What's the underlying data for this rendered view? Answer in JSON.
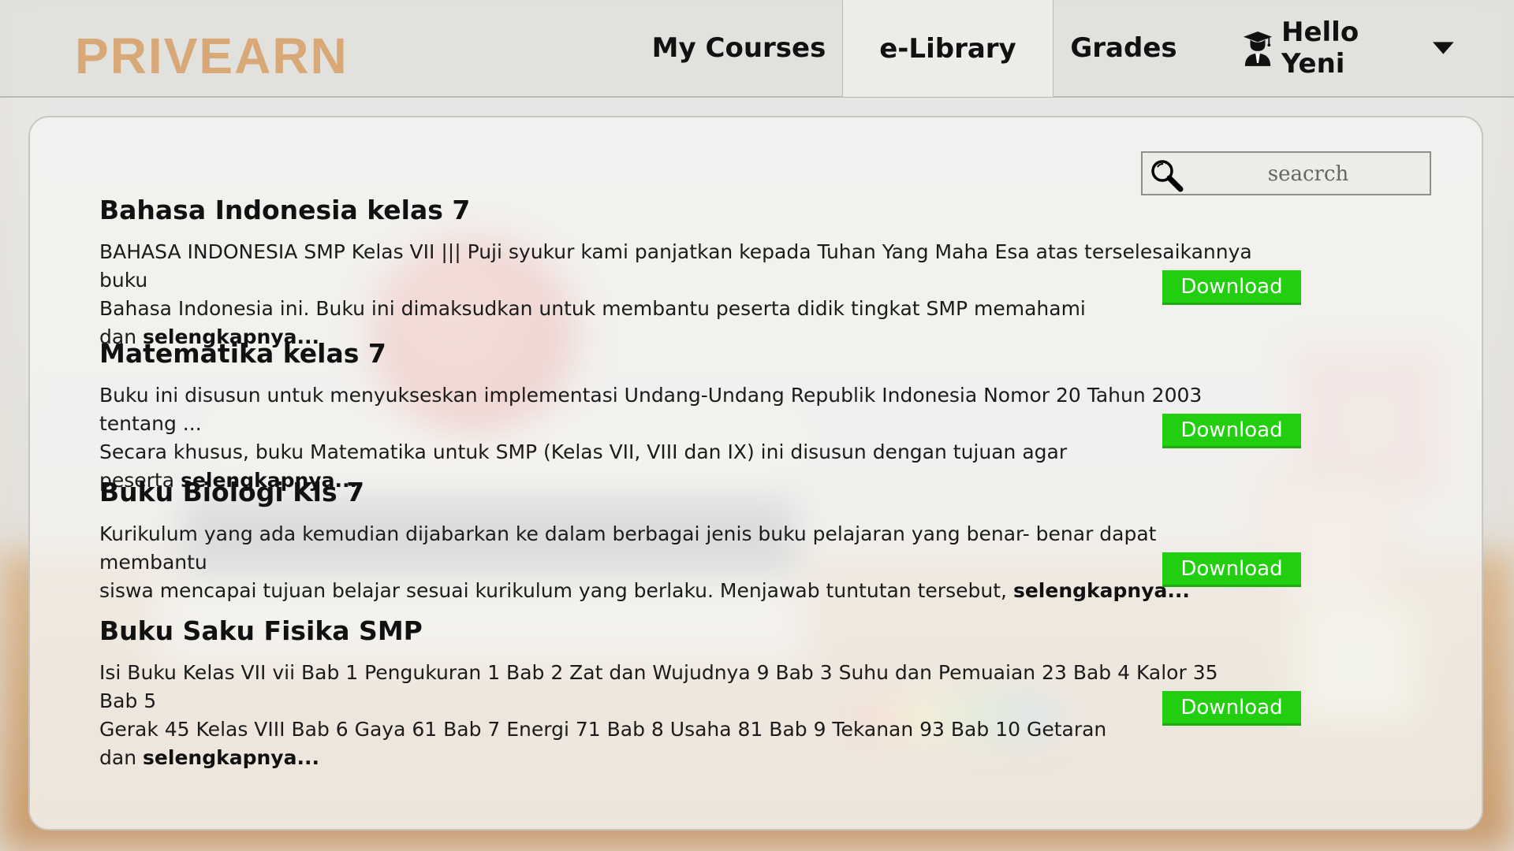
{
  "header": {
    "logo": "PRIVEARN",
    "nav": {
      "my_courses": "My Courses",
      "e_library": "e-Library",
      "grades": "Grades"
    },
    "user": {
      "greeting": "Hello Yeni",
      "icon": "user-graduate-icon",
      "caret_icon": "caret-down-icon"
    },
    "active_tab": "e-Library"
  },
  "search": {
    "placeholder": "seacrch",
    "icon": "magnifier-icon"
  },
  "books": [
    {
      "title": "Bahasa Indonesia kelas 7",
      "line1": "BAHASA INDONESIA SMP Kelas VII ||| Puji syukur kami panjatkan kepada Tuhan Yang Maha Esa atas terselesaikannya buku",
      "line2": "Bahasa Indonesia ini. Buku ini dimaksudkan untuk membantu peserta didik tingkat SMP memahami dan",
      "more": "selengkapnya...",
      "download": "Download"
    },
    {
      "title": "Matematika kelas 7",
      "line1": "Buku ini disusun untuk menyukseskan implementasi Undang-Undang Republik Indonesia Nomor 20 Tahun 2003 tentang ...",
      "line2": "Secara khusus, buku Matematika untuk SMP (Kelas VII, VIII dan IX) ini disusun dengan tujuan agar peserta",
      "more": "selengkapnya...",
      "download": "Download"
    },
    {
      "title": "Buku Biologi Kls 7",
      "line1": "Kurikulum yang ada kemudian dijabarkan ke dalam berbagai jenis buku pelajaran yang benar- benar dapat membantu",
      "line2": "siswa mencapai tujuan belajar sesuai kurikulum yang berlaku. Menjawab tuntutan tersebut,",
      "more": "selengkapnya...",
      "download": "Download"
    },
    {
      "title": "Buku Saku Fisika SMP",
      "line1": "Isi Buku Kelas VII vii Bab 1 Pengukuran 1 Bab 2 Zat dan Wujudnya 9 Bab 3 Suhu dan Pemuaian 23 Bab 4 Kalor 35 Bab 5",
      "line2": "Gerak 45 Kelas VIII Bab 6 Gaya 61 Bab 7 Energi 71 Bab 8 Usaha 81 Bab 9 Tekanan 93 Bab 10 Getaran dan",
      "more": "selengkapnya...",
      "download": "Download"
    }
  ],
  "colors": {
    "logo": "#d9a877",
    "download_button": "#22cf10",
    "active_tab_bg": "#ececE8"
  }
}
